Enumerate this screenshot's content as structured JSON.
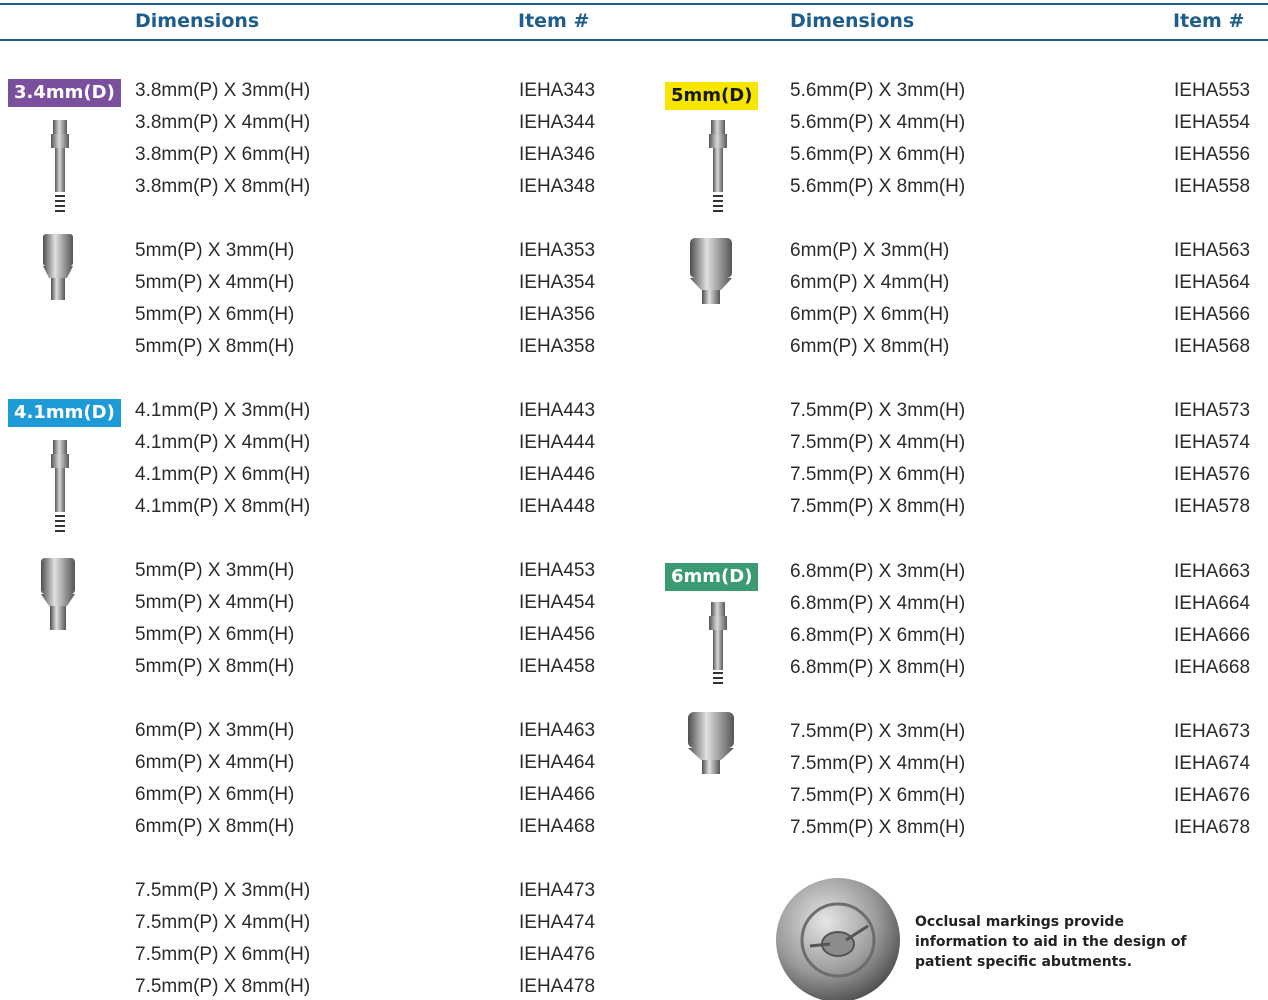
{
  "header": {
    "left_dimensions": "Dimensions",
    "left_item": "Item #",
    "right_dimensions": "Dimensions",
    "right_item": "Item #"
  },
  "colors": {
    "header_blue": "#1f5d8c",
    "badge_34": "#7a4f9e",
    "badge_41": "#1e9bd7",
    "badge_5": "#f7e600",
    "badge_6": "#3a9a72"
  },
  "badges": {
    "d34": "3.4mm(D)",
    "d41": "4.1mm(D)",
    "d5": "5mm(D)",
    "d6": "6mm(D)"
  },
  "left_rows": [
    {
      "dim": "3.8mm(P) X 3mm(H)",
      "item": "IEHA343"
    },
    {
      "dim": "3.8mm(P) X 4mm(H)",
      "item": "IEHA344"
    },
    {
      "dim": "3.8mm(P) X 6mm(H)",
      "item": "IEHA346"
    },
    {
      "dim": "3.8mm(P) X 8mm(H)",
      "item": "IEHA348"
    },
    {
      "dim": "5mm(P) X 3mm(H)",
      "item": "IEHA353"
    },
    {
      "dim": "5mm(P) X 4mm(H)",
      "item": "IEHA354"
    },
    {
      "dim": "5mm(P) X 6mm(H)",
      "item": "IEHA356"
    },
    {
      "dim": "5mm(P) X 8mm(H)",
      "item": "IEHA358"
    },
    {
      "dim": "4.1mm(P) X 3mm(H)",
      "item": "IEHA443"
    },
    {
      "dim": "4.1mm(P) X 4mm(H)",
      "item": "IEHA444"
    },
    {
      "dim": "4.1mm(P) X 6mm(H)",
      "item": "IEHA446"
    },
    {
      "dim": "4.1mm(P) X 8mm(H)",
      "item": "IEHA448"
    },
    {
      "dim": "5mm(P) X 3mm(H)",
      "item": "IEHA453"
    },
    {
      "dim": "5mm(P) X 4mm(H)",
      "item": "IEHA454"
    },
    {
      "dim": "5mm(P) X 6mm(H)",
      "item": "IEHA456"
    },
    {
      "dim": "5mm(P) X 8mm(H)",
      "item": "IEHA458"
    },
    {
      "dim": "6mm(P) X 3mm(H)",
      "item": "IEHA463"
    },
    {
      "dim": "6mm(P) X 4mm(H)",
      "item": "IEHA464"
    },
    {
      "dim": "6mm(P) X 6mm(H)",
      "item": "IEHA466"
    },
    {
      "dim": "6mm(P) X 8mm(H)",
      "item": "IEHA468"
    },
    {
      "dim": "7.5mm(P) X 3mm(H)",
      "item": "IEHA473"
    },
    {
      "dim": "7.5mm(P) X 4mm(H)",
      "item": "IEHA474"
    },
    {
      "dim": "7.5mm(P) X 6mm(H)",
      "item": "IEHA476"
    },
    {
      "dim": "7.5mm(P) X 8mm(H)",
      "item": "IEHA478"
    }
  ],
  "right_rows": [
    {
      "dim": "5.6mm(P) X 3mm(H)",
      "item": "IEHA553"
    },
    {
      "dim": "5.6mm(P) X 4mm(H)",
      "item": "IEHA554"
    },
    {
      "dim": "5.6mm(P) X 6mm(H)",
      "item": "IEHA556"
    },
    {
      "dim": "5.6mm(P) X 8mm(H)",
      "item": "IEHA558"
    },
    {
      "dim": "6mm(P) X 3mm(H)",
      "item": "IEHA563"
    },
    {
      "dim": "6mm(P) X 4mm(H)",
      "item": "IEHA564"
    },
    {
      "dim": "6mm(P) X 6mm(H)",
      "item": "IEHA566"
    },
    {
      "dim": "6mm(P) X 8mm(H)",
      "item": "IEHA568"
    },
    {
      "dim": "7.5mm(P) X 3mm(H)",
      "item": "IEHA573"
    },
    {
      "dim": "7.5mm(P) X 4mm(H)",
      "item": "IEHA574"
    },
    {
      "dim": "7.5mm(P) X 6mm(H)",
      "item": "IEHA576"
    },
    {
      "dim": "7.5mm(P) X 8mm(H)",
      "item": "IEHA578"
    },
    {
      "dim": "6.8mm(P) X 3mm(H)",
      "item": "IEHA663"
    },
    {
      "dim": "6.8mm(P) X 4mm(H)",
      "item": "IEHA664"
    },
    {
      "dim": "6.8mm(P) X 6mm(H)",
      "item": "IEHA666"
    },
    {
      "dim": "6.8mm(P) X 8mm(H)",
      "item": "IEHA668"
    },
    {
      "dim": "7.5mm(P) X 3mm(H)",
      "item": "IEHA673"
    },
    {
      "dim": "7.5mm(P) X 4mm(H)",
      "item": "IEHA674"
    },
    {
      "dim": "7.5mm(P) X 6mm(H)",
      "item": "IEHA676"
    },
    {
      "dim": "7.5mm(P) X 8mm(H)",
      "item": "IEHA678"
    }
  ],
  "caption": "Occlusal markings provide information to aid in the design of patient specific abutments."
}
